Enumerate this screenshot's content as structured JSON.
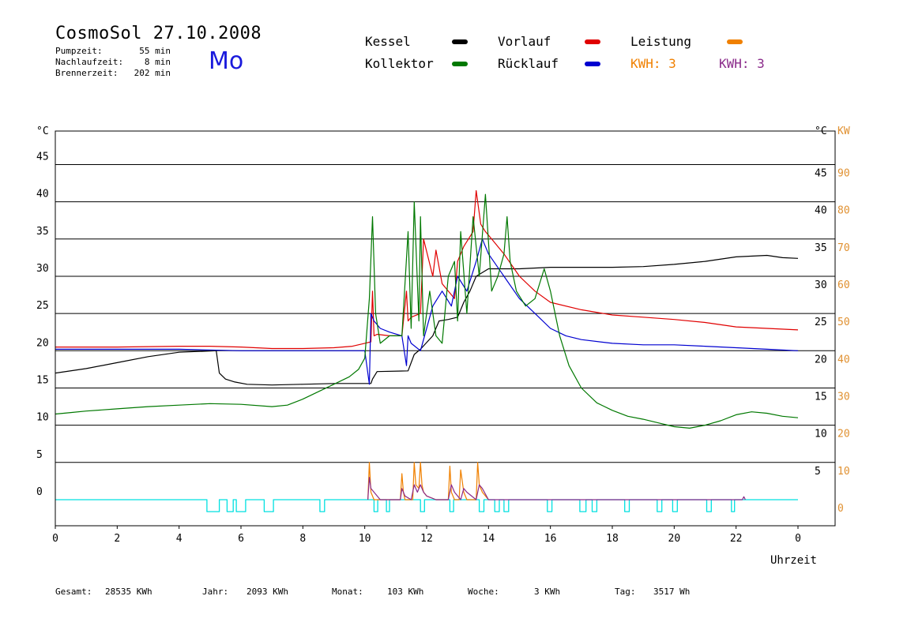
{
  "header": {
    "title": "CosmoSol 27.10.2008",
    "weekday": "Mo",
    "stats": [
      {
        "label": "Pumpzeit:",
        "value": "55 min"
      },
      {
        "label": "Nachlaufzeit:",
        "value": "8 min"
      },
      {
        "label": "Brennerzeit:",
        "value": "202 min"
      }
    ]
  },
  "legend": {
    "kessel": "Kessel",
    "vorlauf": "Vorlauf",
    "leistung": "Leistung",
    "kollektor": "Kollektor",
    "ruecklauf": "Rücklauf",
    "kwh1": "KWH: 3",
    "kwh2": "KWH: 3"
  },
  "footer": {
    "gesamt_label": "Gesamt:",
    "gesamt_value": "28535 KWh",
    "jahr_label": "Jahr:",
    "jahr_value": "2093 KWh",
    "monat_label": "Monat:",
    "monat_value": "103 KWh",
    "woche_label": "Woche:",
    "woche_value": "3 KWh",
    "tag_label": "Tag:",
    "tag_value": "3517 Wh"
  },
  "colors": {
    "kessel": "#000000",
    "vorlauf": "#e00000",
    "ruecklauf": "#0000d0",
    "kollektor": "#007800",
    "leistung": "#f08000",
    "kwh2": "#8a2a8a",
    "pump": "#00e0e0",
    "axis_kw": "#e09030"
  },
  "chart_data": {
    "type": "line",
    "x_label": "Uhrzeit",
    "x_ticks": [
      "0",
      "2",
      "4",
      "6",
      "8",
      "10",
      "12",
      "14",
      "16",
      "18",
      "20",
      "22",
      "0"
    ],
    "xlim": [
      0,
      24
    ],
    "ylim": [
      -3.5,
      49.5
    ],
    "y_left_unit": "°C",
    "y_right_unit_left": "°C",
    "y_right_unit_kw": "KW",
    "y_left_ticks": [
      "0",
      "5",
      "10",
      "15",
      "20",
      "25",
      "30",
      "35",
      "40",
      "45"
    ],
    "y_right_ticks": [
      "5",
      "10",
      "15",
      "20",
      "25",
      "30",
      "35",
      "40",
      "45"
    ],
    "y_kw_ticks": [
      "0",
      "10",
      "20",
      "30",
      "40",
      "50",
      "60",
      "70",
      "80",
      "90"
    ],
    "grid": true,
    "series": [
      {
        "name": "Kessel",
        "key": "kessel",
        "x": [
          0,
          1,
          2,
          3,
          4,
          5.2,
          5.3,
          5.5,
          5.8,
          6.2,
          7,
          8,
          9,
          10.2,
          10.25,
          10.4,
          11.4,
          11.6,
          11.8,
          12.2,
          12.4,
          12.7,
          13,
          13.2,
          13.4,
          13.6,
          13.8,
          14,
          14.5,
          15,
          16,
          17,
          18,
          19,
          20,
          21,
          22,
          23,
          23.5,
          24
        ],
        "y": [
          17,
          17.6,
          18.4,
          19.2,
          19.8,
          20,
          17,
          16.2,
          15.8,
          15.5,
          15.4,
          15.5,
          15.6,
          15.6,
          16.2,
          17.2,
          17.3,
          19.5,
          20.2,
          22,
          24,
          24.2,
          24.5,
          26.5,
          28,
          30,
          30.5,
          31,
          31,
          31,
          31.2,
          31.2,
          31.2,
          31.3,
          31.6,
          32,
          32.6,
          32.8,
          32.5,
          32.4
        ]
      },
      {
        "name": "Vorlauf",
        "key": "vorlauf",
        "x": [
          0,
          2,
          4,
          5,
          6,
          7,
          8,
          9,
          9.6,
          10,
          10.2,
          10.25,
          10.3,
          10.4,
          10.8,
          11.2,
          11.35,
          11.4,
          11.5,
          11.8,
          11.9,
          12.2,
          12.3,
          12.5,
          12.9,
          13,
          13.2,
          13.5,
          13.6,
          13.75,
          13.9,
          14.1,
          14.5,
          15,
          15.5,
          16,
          17,
          18,
          19,
          20,
          21,
          22,
          23,
          24
        ],
        "y": [
          20.5,
          20.5,
          20.6,
          20.6,
          20.5,
          20.3,
          20.3,
          20.4,
          20.6,
          21,
          21.2,
          28,
          22,
          22.2,
          22,
          22,
          28,
          24,
          24.5,
          25,
          35,
          30,
          33.5,
          29,
          27,
          32,
          34,
          36,
          41.5,
          37,
          36,
          35,
          33,
          30,
          28,
          26.5,
          25.5,
          24.8,
          24.5,
          24.2,
          23.8,
          23.2,
          23,
          22.8
        ]
      },
      {
        "name": "Rücklauf",
        "key": "ruecklauf",
        "x": [
          0,
          2,
          4,
          6,
          8,
          9,
          10,
          10.15,
          10.2,
          10.3,
          10.5,
          10.8,
          11.2,
          11.35,
          11.4,
          11.5,
          11.8,
          12.2,
          12.5,
          12.8,
          13,
          13.3,
          13.6,
          13.8,
          14,
          14.5,
          15,
          15.5,
          16,
          16.5,
          17,
          18,
          19,
          20,
          21,
          22,
          23,
          24
        ],
        "y": [
          20.2,
          20.2,
          20.2,
          20,
          20,
          20,
          20,
          15.5,
          25,
          24,
          23,
          22.5,
          22,
          18,
          22,
          21,
          20,
          26,
          28,
          26,
          30,
          28,
          32,
          35,
          33,
          30,
          27,
          25,
          23,
          22,
          21.5,
          21,
          20.8,
          20.8,
          20.6,
          20.4,
          20.2,
          20
        ]
      },
      {
        "name": "Kollektor",
        "key": "kollektor",
        "x": [
          0,
          0.5,
          1,
          2,
          3,
          4,
          5,
          6,
          7,
          7.5,
          8,
          8.5,
          9,
          9.5,
          9.8,
          10,
          10.15,
          10.25,
          10.35,
          10.5,
          10.8,
          11.2,
          11.4,
          11.5,
          11.6,
          11.75,
          11.8,
          11.9,
          12,
          12.1,
          12.3,
          12.5,
          12.7,
          12.9,
          13,
          13.1,
          13.3,
          13.5,
          13.7,
          13.9,
          14.1,
          14.3,
          14.5,
          14.6,
          14.7,
          14.9,
          15.2,
          15.5,
          15.8,
          16,
          16.3,
          16.6,
          17,
          17.5,
          18,
          18.5,
          19,
          19.5,
          20,
          20.5,
          21,
          21.5,
          22,
          22.5,
          23,
          23.5,
          24
        ],
        "y": [
          11.5,
          11.7,
          11.9,
          12.2,
          12.5,
          12.7,
          12.9,
          12.8,
          12.5,
          12.7,
          13.5,
          14.5,
          15.5,
          16.5,
          17.5,
          19,
          27,
          38,
          25,
          21,
          22,
          22,
          36,
          23,
          40,
          24,
          38,
          22,
          25,
          28,
          22,
          21,
          30,
          32,
          24,
          36,
          25,
          38,
          30,
          41,
          28,
          30,
          33,
          38,
          32,
          28,
          26,
          27,
          31,
          28,
          22,
          18,
          15,
          13,
          12,
          11.2,
          10.8,
          10.3,
          9.8,
          9.6,
          10,
          10.6,
          11.4,
          11.8,
          11.6,
          11.2,
          11
        ]
      },
      {
        "name": "Leistung",
        "key": "leistung",
        "x": [
          10.1,
          10.15,
          10.2,
          10.3,
          11.15,
          11.2,
          11.25,
          11.3,
          11.55,
          11.6,
          11.65,
          11.75,
          11.8,
          11.85,
          11.9,
          12,
          12.3,
          12.7,
          12.75,
          12.8,
          12.9,
          13.05,
          13.1,
          13.2,
          13.3,
          13.6,
          13.65,
          13.7,
          13.8,
          14
        ],
        "y": [
          0,
          5,
          1,
          0,
          0,
          3.5,
          1,
          0,
          0,
          5,
          2,
          1.5,
          5,
          2,
          1,
          0.5,
          0,
          0,
          4.5,
          1,
          0,
          0,
          4,
          1,
          0,
          0,
          5,
          2,
          1,
          0
        ]
      },
      {
        "name": "KWH",
        "key": "kwh2",
        "x": [
          10.1,
          10.15,
          10.2,
          10.3,
          10.5,
          11.15,
          11.2,
          11.3,
          11.5,
          11.6,
          11.7,
          11.8,
          11.9,
          12,
          12.3,
          12.7,
          12.8,
          12.9,
          13.1,
          13.2,
          13.3,
          13.6,
          13.7,
          13.8,
          14,
          22.2,
          22.25,
          22.3
        ],
        "y": [
          0,
          3,
          1.5,
          1,
          0,
          0,
          1.5,
          0.5,
          0,
          2,
          1,
          2,
          1,
          0.5,
          0,
          0,
          2,
          1,
          0,
          1.5,
          1,
          0,
          2,
          1.5,
          0,
          0,
          0.4,
          0
        ]
      },
      {
        "name": "Pumpe",
        "key": "pump",
        "x": [
          0,
          4.9,
          4.9,
          5.3,
          5.3,
          5.55,
          5.55,
          5.75,
          5.75,
          5.85,
          5.85,
          6.15,
          6.15,
          6.75,
          6.75,
          7.05,
          7.05,
          8.55,
          8.55,
          8.7,
          8.7,
          10.3,
          10.3,
          10.42,
          10.42,
          10.7,
          10.7,
          10.8,
          10.8,
          11.8,
          11.8,
          11.93,
          11.93,
          12.75,
          12.75,
          12.87,
          12.87,
          13.7,
          13.7,
          13.85,
          13.85,
          14.2,
          14.2,
          14.35,
          14.35,
          14.5,
          14.5,
          14.65,
          14.65,
          15.9,
          15.9,
          16.05,
          16.05,
          16.95,
          16.95,
          17.15,
          17.15,
          17.35,
          17.35,
          17.5,
          17.5,
          18.4,
          18.4,
          18.55,
          18.55,
          19.45,
          19.45,
          19.6,
          19.6,
          19.95,
          19.95,
          20.1,
          20.1,
          21.05,
          21.05,
          21.2,
          21.2,
          21.85,
          21.85,
          21.95,
          21.95,
          24
        ],
        "y": [
          0,
          0,
          -1.6,
          -1.6,
          0,
          0,
          -1.6,
          -1.6,
          0,
          0,
          -1.6,
          -1.6,
          0,
          0,
          -1.6,
          -1.6,
          0,
          0,
          -1.6,
          -1.6,
          0,
          0,
          -1.6,
          -1.6,
          0,
          0,
          -1.6,
          -1.6,
          0,
          0,
          -1.6,
          -1.6,
          0,
          0,
          -1.6,
          -1.6,
          0,
          0,
          -1.6,
          -1.6,
          0,
          0,
          -1.6,
          -1.6,
          0,
          0,
          -1.6,
          -1.6,
          0,
          0,
          -1.6,
          -1.6,
          0,
          0,
          -1.6,
          -1.6,
          0,
          0,
          -1.6,
          -1.6,
          0,
          0,
          -1.6,
          -1.6,
          0,
          0,
          -1.6,
          -1.6,
          0,
          0,
          -1.6,
          -1.6,
          0,
          0,
          -1.6,
          -1.6,
          0,
          0,
          -1.6,
          -1.6,
          0,
          0
        ]
      }
    ]
  }
}
